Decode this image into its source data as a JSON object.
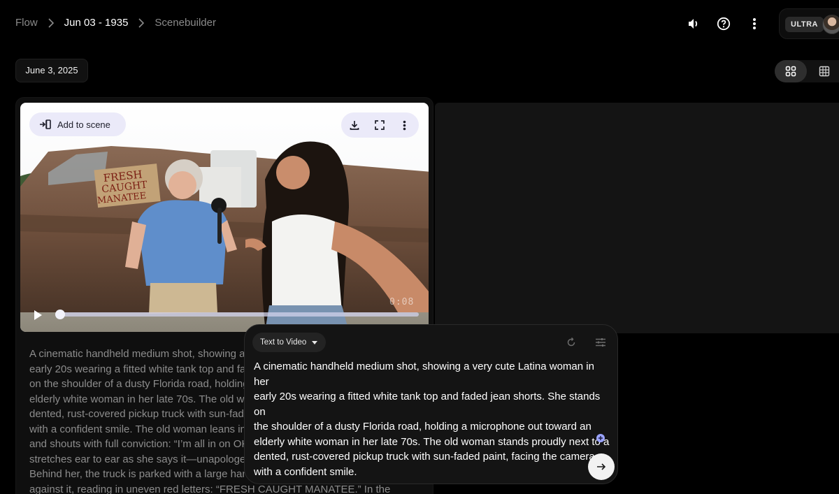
{
  "breadcrumb": {
    "items": [
      "Flow",
      "Jun 03 - 1935",
      "Scenebuilder"
    ]
  },
  "header": {
    "plan_badge": "ULTRA",
    "icons": [
      "volume-icon",
      "help-icon",
      "more-vert-icon"
    ]
  },
  "date_chip": "June 3, 2025",
  "view_toggle": {
    "options": [
      "grid-view-icon",
      "table-view-icon"
    ],
    "selected": "grid-view-icon"
  },
  "video": {
    "add_to_scene_label": "Add to scene",
    "actions": [
      "download-icon",
      "fullscreen-icon",
      "more-vert-icon"
    ],
    "duration_label": "0:08",
    "progress": 0
  },
  "background_prompt_lines": [
    "A cinematic handheld medium shot, showing a v",
    "early 20s wearing a fitted white tank top and fad",
    "on the shoulder of a dusty Florida road, holding",
    "elderly white woman in her late 70s. The old wo",
    "dented, rust-covered pickup truck with sun-fad",
    "with a confident smile. The old woman leans in t",
    "and shouts with full conviction: “I’m all in on OK",
    "stretches ear to ear as she says it—unapologeti",
    "Behind her, the truck is parked with a large hand",
    "against it, reading in uneven red letters: “FRESH CAUGHT MANATEE.” In the"
  ],
  "composer": {
    "mode_label": "Text to Video",
    "prompt_lines": [
      "A cinematic handheld medium shot, showing a very cute Latina woman in her",
      "early 20s wearing a fitted white tank top and faded jean shorts. She stands on",
      "the shoulder of a dusty Florida road, holding a microphone out toward an",
      "elderly white woman in her late 70s. The old woman stands proudly next to a",
      "dented, rust-covered pickup truck with sun-faded paint, facing the camera",
      "with a confident smile."
    ]
  },
  "colors": {
    "background": "#000000",
    "panel": "#0f0f0f",
    "pill": "#e9e8f8",
    "accent": "#9aa3ff"
  },
  "scene_sign_text": [
    "FRESH",
    "CAUGHT",
    "MANATEE"
  ]
}
